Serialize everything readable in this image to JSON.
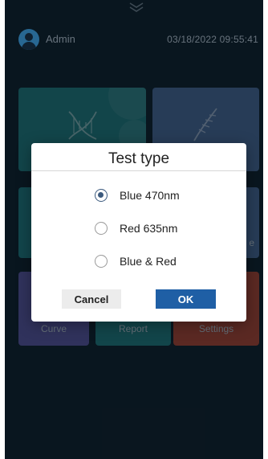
{
  "header": {
    "user": "Admin",
    "datetime": "03/18/2022 09:55:41"
  },
  "tiles": {
    "curve": "Curve",
    "report": "Report",
    "settings": "Settings",
    "partial_label": "e"
  },
  "dialog": {
    "title": "Test type",
    "options": [
      {
        "label": "Blue 470nm",
        "checked": true
      },
      {
        "label": "Red 635nm",
        "checked": false
      },
      {
        "label": "Blue & Red",
        "checked": false
      }
    ],
    "cancel_label": "Cancel",
    "ok_label": "OK"
  },
  "colors": {
    "background": "#0f2230",
    "accent": "#1f5fa5",
    "radio_selected": "#3c5a7e"
  }
}
